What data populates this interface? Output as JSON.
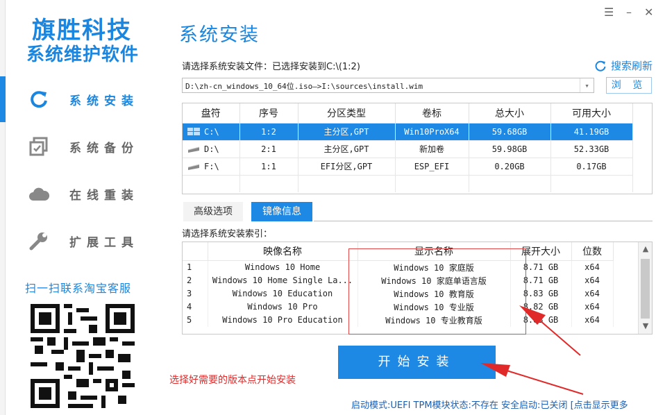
{
  "sidebar": {
    "brand_line1": "旗胜科技",
    "brand_line2": "系统维护软件",
    "items": [
      {
        "label": "系统安装",
        "icon": "refresh-icon",
        "active": true
      },
      {
        "label": "系统备份",
        "icon": "backup-icon",
        "active": false
      },
      {
        "label": "在线重装",
        "icon": "cloud-icon",
        "active": false
      },
      {
        "label": "扩展工具",
        "icon": "wrench-icon",
        "active": false
      }
    ],
    "scan_text": "扫一扫联系淘宝客服",
    "qr_icon": "qr-code-icon"
  },
  "header": {
    "title": "系统安装",
    "window_controls": {
      "menu": "☰",
      "minimize": "–",
      "close": "✕"
    }
  },
  "file_select": {
    "label": "请选择系统安装文件：已选择安装到C:\\(1:2)",
    "refresh_label": "搜索刷新",
    "value": "D:\\zh-cn_windows_10_64位.iso—>I:\\sources\\install.wim",
    "browse_label": "浏 览"
  },
  "partitions": {
    "headers": [
      "盘符",
      "序号",
      "分区类型",
      "卷标",
      "总大小",
      "可用大小"
    ],
    "rows": [
      {
        "drive": "C:\\",
        "index": "1:2",
        "type": "主分区,GPT",
        "volume": "Win10ProX64",
        "total": "59.68GB",
        "free": "41.19GB",
        "selected": true
      },
      {
        "drive": "D:\\",
        "index": "2:1",
        "type": "主分区,GPT",
        "volume": "新加卷",
        "total": "59.98GB",
        "free": "52.33GB",
        "selected": false
      },
      {
        "drive": "F:\\",
        "index": "1:1",
        "type": "EFI分区,GPT",
        "volume": "ESP_EFI",
        "total": "0.20GB",
        "free": "0.17GB",
        "selected": false
      }
    ]
  },
  "tabs": {
    "advanced": "高级选项",
    "image_info": "镜像信息"
  },
  "index_label": "请选择系统安装索引：",
  "images": {
    "headers": [
      "映像名称",
      "显示名称",
      "展开大小",
      "位数"
    ],
    "rows": [
      {
        "n": "1",
        "name": "Windows 10 Home",
        "display": "Windows 10 家庭版",
        "size": "8.71 GB",
        "bits": "x64"
      },
      {
        "n": "2",
        "name": "Windows 10 Home Single La...",
        "display": "Windows 10 家庭单语言版",
        "size": "8.71 GB",
        "bits": "x64"
      },
      {
        "n": "3",
        "name": "Windows 10 Education",
        "display": "Windows 10 教育版",
        "size": "8.83 GB",
        "bits": "x64"
      },
      {
        "n": "4",
        "name": "Windows 10 Pro",
        "display": "Windows 10 专业版",
        "size": "8.82 GB",
        "bits": "x64"
      },
      {
        "n": "5",
        "name": "Windows 10 Pro Education",
        "display": "Windows 10 专业教育版",
        "size": "8.83 GB",
        "bits": "x64"
      }
    ]
  },
  "install_button": "开始安装",
  "hint": "选择好需要的版本点开始安装",
  "status_bar": "启动模式:UEFI TPM模块状态:不存在 安全启动:已关闭 [点击显示更多",
  "colors": {
    "accent": "#1e88e5",
    "annotation": "#e02a2a"
  }
}
